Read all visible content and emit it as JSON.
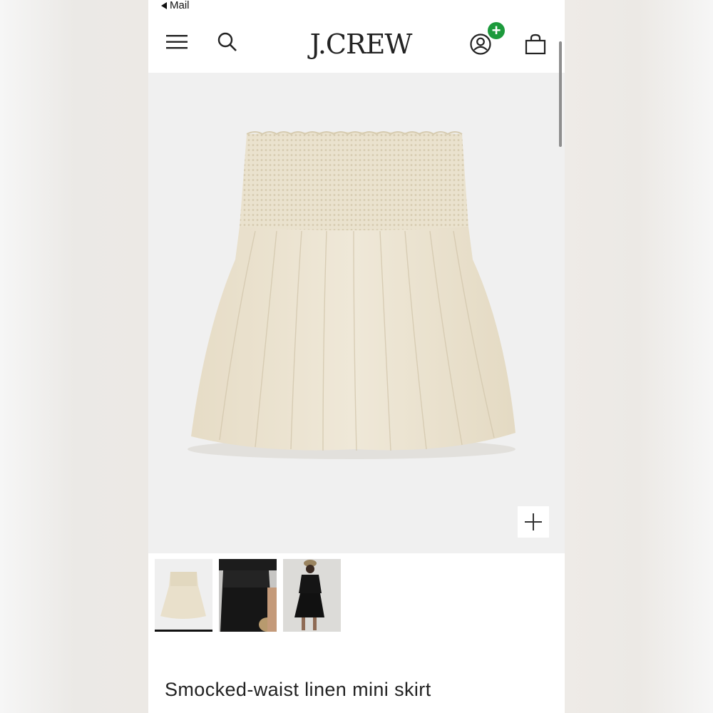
{
  "status_bar": {
    "back_label": "Mail"
  },
  "header": {
    "logo": "J.CREW",
    "account_badge": "+",
    "icons": [
      "menu-icon",
      "search-icon",
      "account-icon",
      "bag-icon"
    ]
  },
  "gallery": {
    "thumbnails": [
      {
        "name": "thumbnail-skirt-flat"
      },
      {
        "name": "thumbnail-model-close"
      },
      {
        "name": "thumbnail-model-full"
      }
    ],
    "selected_index": 0
  },
  "product": {
    "title": "Smocked-waist linen mini skirt"
  },
  "colors": {
    "badge": "#1c9a3c",
    "fabric": "#eee7d7",
    "background": "#f0f0f0"
  }
}
